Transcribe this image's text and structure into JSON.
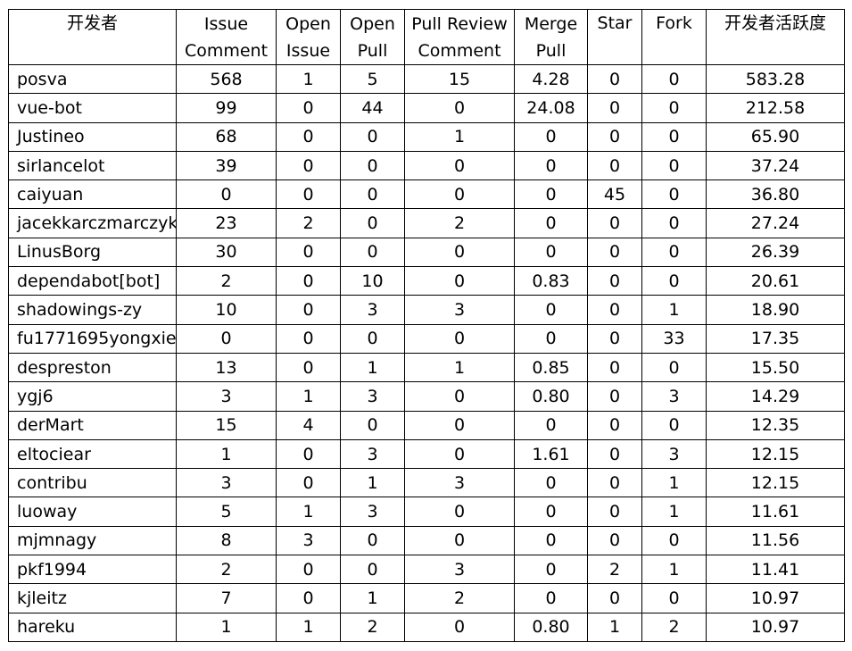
{
  "table": {
    "headers": [
      "开发者",
      "Issue Comment",
      "Open Issue",
      "Open Pull",
      "Pull Review Comment",
      "Merge Pull",
      "Star",
      "Fork",
      "开发者活跃度"
    ],
    "header_lines": [
      [
        "开发者",
        ""
      ],
      [
        "Issue",
        "Comment"
      ],
      [
        "Open",
        "Issue"
      ],
      [
        "Open",
        "Pull"
      ],
      [
        "Pull Review",
        "Comment"
      ],
      [
        "Merge",
        "Pull"
      ],
      [
        "Star",
        ""
      ],
      [
        "Fork",
        ""
      ],
      [
        "开发者活跃度",
        ""
      ]
    ],
    "rows": [
      [
        "posva",
        "568",
        "1",
        "5",
        "15",
        "4.28",
        "0",
        "0",
        "583.28"
      ],
      [
        "vue-bot",
        "99",
        "0",
        "44",
        "0",
        "24.08",
        "0",
        "0",
        "212.58"
      ],
      [
        "Justineo",
        "68",
        "0",
        "0",
        "1",
        "0",
        "0",
        "0",
        "65.90"
      ],
      [
        "sirlancelot",
        "39",
        "0",
        "0",
        "0",
        "0",
        "0",
        "0",
        "37.24"
      ],
      [
        "caiyuan",
        "0",
        "0",
        "0",
        "0",
        "0",
        "45",
        "0",
        "36.80"
      ],
      [
        "jacekkarczmarczyk",
        "23",
        "2",
        "0",
        "2",
        "0",
        "0",
        "0",
        "27.24"
      ],
      [
        "LinusBorg",
        "30",
        "0",
        "0",
        "0",
        "0",
        "0",
        "0",
        "26.39"
      ],
      [
        "dependabot[bot]",
        "2",
        "0",
        "10",
        "0",
        "0.83",
        "0",
        "0",
        "20.61"
      ],
      [
        "shadowings-zy",
        "10",
        "0",
        "3",
        "3",
        "0",
        "0",
        "1",
        "18.90"
      ],
      [
        "fu1771695yongxie",
        "0",
        "0",
        "0",
        "0",
        "0",
        "0",
        "33",
        "17.35"
      ],
      [
        "despreston",
        "13",
        "0",
        "1",
        "1",
        "0.85",
        "0",
        "0",
        "15.50"
      ],
      [
        "ygj6",
        "3",
        "1",
        "3",
        "0",
        "0.80",
        "0",
        "3",
        "14.29"
      ],
      [
        "derMart",
        "15",
        "4",
        "0",
        "0",
        "0",
        "0",
        "0",
        "12.35"
      ],
      [
        "eltociear",
        "1",
        "0",
        "3",
        "0",
        "1.61",
        "0",
        "3",
        "12.15"
      ],
      [
        "contribu",
        "3",
        "0",
        "1",
        "3",
        "0",
        "0",
        "1",
        "12.15"
      ],
      [
        "luoway",
        "5",
        "1",
        "3",
        "0",
        "0",
        "0",
        "1",
        "11.61"
      ],
      [
        "mjmnagy",
        "8",
        "3",
        "0",
        "0",
        "0",
        "0",
        "0",
        "11.56"
      ],
      [
        "pkf1994",
        "2",
        "0",
        "0",
        "3",
        "0",
        "2",
        "1",
        "11.41"
      ],
      [
        "kjleitz",
        "7",
        "0",
        "1",
        "2",
        "0",
        "0",
        "0",
        "10.97"
      ],
      [
        "hareku",
        "1",
        "1",
        "2",
        "0",
        "0.80",
        "1",
        "2",
        "10.97"
      ]
    ]
  }
}
